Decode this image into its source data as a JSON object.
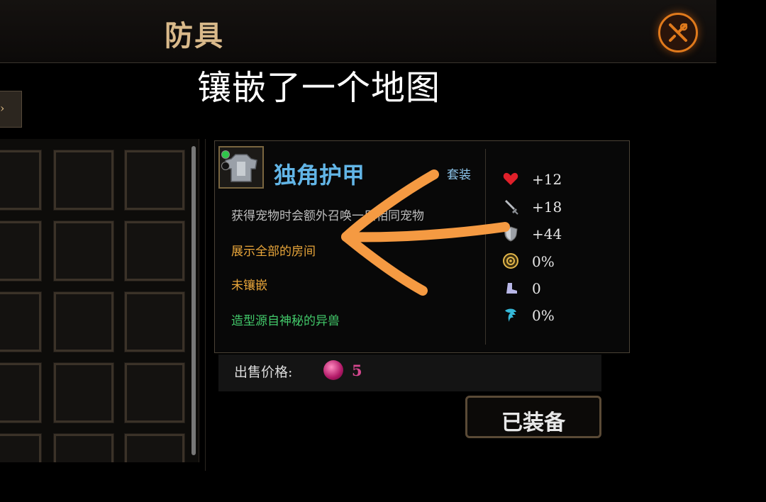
{
  "header": {
    "title": "防具"
  },
  "annotation": {
    "text": "镶嵌了一个地图"
  },
  "side_tab": {
    "glyph": "›"
  },
  "item": {
    "name": "独角护甲",
    "set_label": "套装",
    "descriptions": [
      {
        "text": "获得宠物时会额外召唤一只相同宠物",
        "color": "#bdbdbd"
      },
      {
        "text": "展示全部的房间",
        "color": "#e9a63a"
      },
      {
        "text": "未镶嵌",
        "color": "#e9a63a"
      },
      {
        "text": "造型源自神秘的异兽",
        "color": "#42c96a"
      }
    ],
    "stats": [
      {
        "icon": "heart-icon",
        "value": "+12"
      },
      {
        "icon": "sword-icon",
        "value": "+18"
      },
      {
        "icon": "shield-icon",
        "value": "+44"
      },
      {
        "icon": "crit-icon",
        "value": "0%"
      },
      {
        "icon": "boot-icon",
        "value": "0"
      },
      {
        "icon": "dodge-icon",
        "value": "0%"
      }
    ]
  },
  "price": {
    "label": "出售价格:",
    "value": "5"
  },
  "equip_button": {
    "label": "已装备"
  },
  "colors": {
    "accent": "#e07a1c",
    "item_name": "#62b5e6",
    "annotation_arrow": "#f59a42"
  }
}
